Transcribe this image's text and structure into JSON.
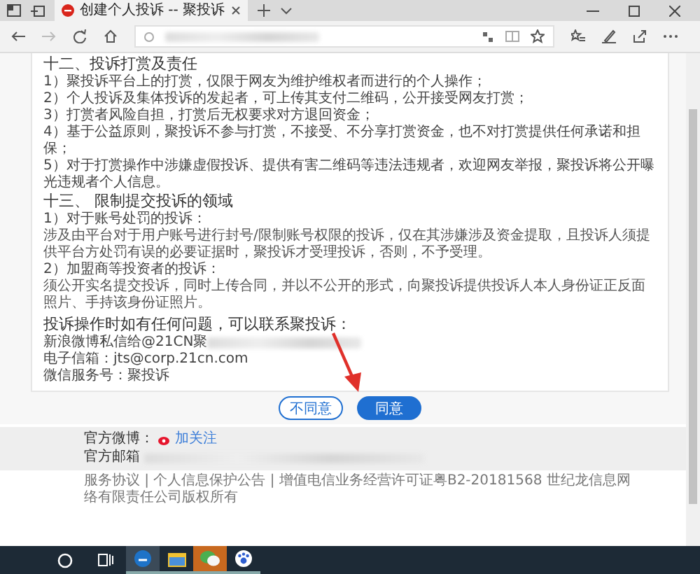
{
  "browser": {
    "tabs": [
      {
        "title": "创建个人投诉 -- 聚投诉",
        "selected": true
      }
    ],
    "address": {
      "redacted": true
    }
  },
  "sections": [
    {
      "heading": "十二、投诉打赏及责任",
      "lines": [
        {
          "kind": "item",
          "text": "1）聚投诉平台上的打赏，仅限于网友为维护维权者而进行的个人操作；"
        },
        {
          "kind": "item",
          "text": "2）个人投诉及集体投诉的发起者，可上传其支付二维码，公开接受网友打赏；"
        },
        {
          "kind": "item",
          "text": "3）打赏者风险自担，打赏后无权要求对方退回资金；"
        },
        {
          "kind": "item",
          "text": "4）基于公益原则，聚投诉不参与打赏，不接受、不分享打赏资金，也不对打赏提供任何承诺和担保；"
        },
        {
          "kind": "item",
          "text": "5）对于打赏操作中涉嫌虚假投诉、提供有害二维码等违法违规者，欢迎网友举报，聚投诉将公开曝光违规者个人信息。"
        }
      ]
    },
    {
      "heading": "十三、 限制提交投诉的领域",
      "lines": [
        {
          "kind": "item",
          "text": "1）对于账号处罚的投诉："
        },
        {
          "kind": "paragraph",
          "text": "涉及由平台对于用户账号进行封号/限制账号权限的投诉，仅在其涉嫌涉及资金提取，且投诉人须提供平台方处罚有误的必要证据时，聚投诉才受理投诉，否则，不予受理。"
        },
        {
          "kind": "item",
          "text": "2）加盟商等投资者的投诉："
        },
        {
          "kind": "paragraph",
          "text": "须公开实名提交投诉，同时上传合同，并以不公开的形式，向聚投诉提供投诉人本人身份证正反面照片、手持该身份证照片。"
        }
      ]
    }
  ],
  "contact": {
    "heading": "投诉操作时如有任何问题，可以联系聚投诉：",
    "lines": [
      {
        "text": "新浪微博私信给@21CN聚",
        "redacted": true
      },
      {
        "text": "电子信箱：jts@corp.21cn.com",
        "redacted": false
      },
      {
        "text": "微信服务号：聚投诉",
        "redacted": false
      }
    ]
  },
  "buttons": [
    {
      "label": "不同意",
      "kind": "outline"
    },
    {
      "label": "同意",
      "kind": "primary"
    }
  ],
  "footer": {
    "weibo_label": "官方微博：",
    "follow_link": "加关注",
    "email_label": "官方邮箱",
    "email_redacted": true,
    "legal": "服务协议 | 个人信息保护公告 | 增值电信业务经营许可证粤B2-20181568 世纪龙信息网络有限责任公司版权所有"
  }
}
